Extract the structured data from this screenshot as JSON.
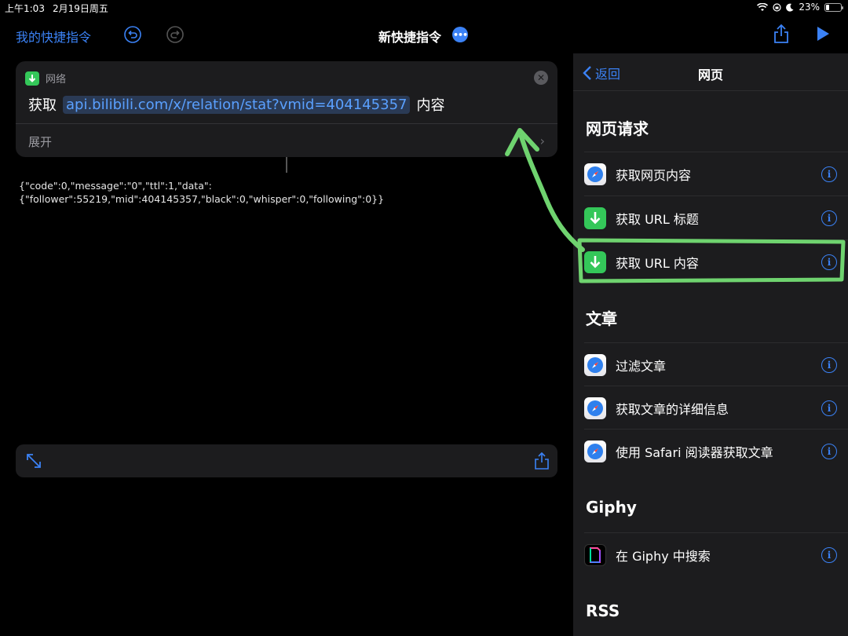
{
  "status_bar": {
    "time": "上午1:03",
    "date": "2月19日周五",
    "battery": "23%",
    "battery_level": 0.23
  },
  "nav": {
    "back_label": "我的快捷指令",
    "title": "新快捷指令",
    "more_label": "•••"
  },
  "action_card": {
    "category": "网络",
    "verb": "获取",
    "url": "api.bilibili.com/x/relation/stat?vmid=404145357",
    "suffix": "内容",
    "expand_label": "展开"
  },
  "result": {
    "text": "{\"code\":0,\"message\":\"0\",\"ttl\":1,\"data\":\n{\"follower\":55219,\"mid\":404145357,\"black\":0,\"whisper\":0,\"following\":0}}"
  },
  "panel": {
    "back_label": "返回",
    "title": "网页",
    "sections": [
      {
        "title": "网页请求",
        "items": [
          {
            "label": "获取网页内容",
            "icon": "safari-icon"
          },
          {
            "label": "获取 URL 标题",
            "icon": "download-icon"
          },
          {
            "label": "获取 URL 内容",
            "icon": "download-icon"
          }
        ]
      },
      {
        "title": "文章",
        "items": [
          {
            "label": "过滤文章",
            "icon": "safari-icon"
          },
          {
            "label": "获取文章的详细信息",
            "icon": "safari-icon"
          },
          {
            "label": "使用 Safari 阅读器获取文章",
            "icon": "safari-icon"
          }
        ]
      },
      {
        "title": "Giphy",
        "items": [
          {
            "label": "在 Giphy 中搜索",
            "icon": "giphy-icon"
          }
        ]
      },
      {
        "title": "RSS",
        "items": []
      }
    ]
  },
  "colors": {
    "accent": "#3b82f6",
    "annotation": "#6fd36f",
    "download_green": "#34c759"
  }
}
